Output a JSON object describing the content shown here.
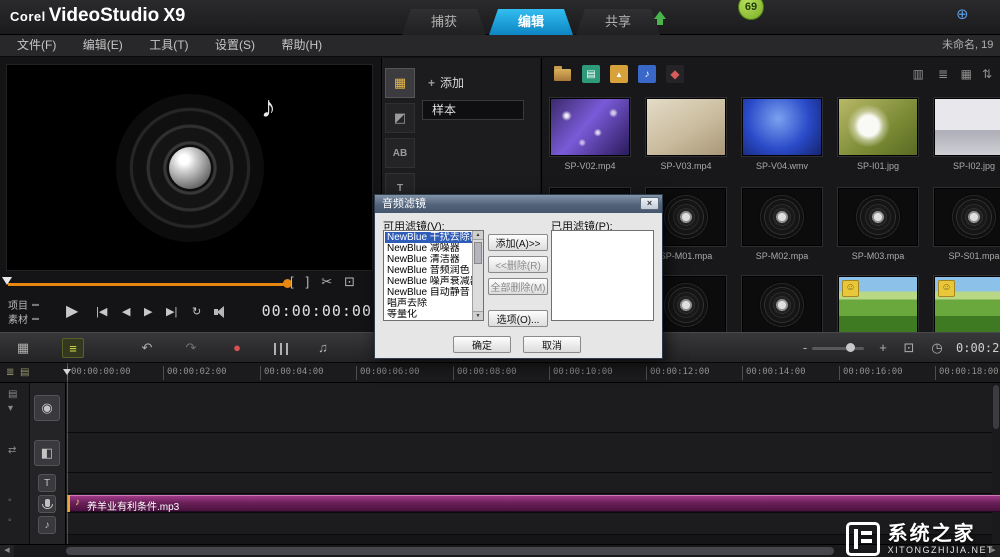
{
  "header": {
    "logo": {
      "corel": "Corel",
      "product": "VideoStudio",
      "version": "X9"
    },
    "tabs": [
      {
        "label": "捕获",
        "active": false
      },
      {
        "label": "编辑",
        "active": true
      },
      {
        "label": "共享",
        "active": false
      }
    ],
    "badge_count": "69"
  },
  "menubar": {
    "items": [
      "文件(F)",
      "编辑(E)",
      "工具(T)",
      "设置(S)",
      "帮助(H)"
    ],
    "project_label": "未命名, 19"
  },
  "preview": {
    "mode_project": "项目",
    "mode_clip": "素材",
    "timecode": "00:00:00:00"
  },
  "options_panel": {
    "add_button": "添加",
    "gallery_label": "样本"
  },
  "library": {
    "row1": [
      {
        "label": "SP-V02.mp4",
        "type": "video-sparkle"
      },
      {
        "label": "SP-V03.mp4",
        "type": "video-beige"
      },
      {
        "label": "SP-V04.wmv",
        "type": "video-blue"
      },
      {
        "label": "SP-I01.jpg",
        "type": "image-dandelion"
      },
      {
        "label": "SP-I02.jpg",
        "type": "image-winter"
      }
    ],
    "row2": [
      {
        "label": "",
        "type": "audio-record"
      },
      {
        "label": "SP-M01.mpa",
        "type": "audio-record"
      },
      {
        "label": "SP-M02.mpa",
        "type": "audio-record"
      },
      {
        "label": "SP-M03.mpa",
        "type": "audio-record"
      },
      {
        "label": "SP-S01.mpa",
        "type": "audio-record"
      }
    ],
    "row3": [
      {
        "type": "audio-record"
      },
      {
        "type": "audio-record"
      },
      {
        "type": "audio-record"
      },
      {
        "type": "video-field"
      },
      {
        "type": "video-field"
      }
    ]
  },
  "dialog": {
    "title": "音频滤镜",
    "available_label": "可用滤镜(V):",
    "applied_label": "已用滤镜(P):",
    "available_filters": [
      {
        "label": "NewBlue 干扰去除器",
        "selected": true
      },
      {
        "label": "NewBlue 减噪器",
        "selected": false
      },
      {
        "label": "NewBlue 清洁器",
        "selected": false
      },
      {
        "label": "NewBlue 音频润色",
        "selected": false
      },
      {
        "label": "NewBlue 噪声衰减器",
        "selected": false
      },
      {
        "label": "NewBlue 自动静音",
        "selected": false
      },
      {
        "label": "唱声去除",
        "selected": false
      },
      {
        "label": "等量化",
        "selected": false
      }
    ],
    "buttons": {
      "add": "添加(A)>>",
      "remove": "<<删除(R)",
      "remove_all": "全部删除(M)",
      "options": "选项(O)...",
      "ok": "确定",
      "cancel": "取消"
    }
  },
  "timeline": {
    "ruler": [
      "00:00:00:00",
      "00:00:02:00",
      "00:00:04:00",
      "00:00:06:00",
      "00:00:08:00",
      "00:00:10:00",
      "00:00:12:00",
      "00:00:14:00",
      "00:00:16:00",
      "00:00:18:00"
    ],
    "clip_label": "养羊业有利条件.mp3",
    "duration": "0:00:2"
  },
  "watermark": {
    "brand": "系统之家",
    "site": "XITONGZHIJIA.NET"
  },
  "icons": {
    "globe": "⊕",
    "close": "×",
    "note": "♪",
    "add_plus": "+",
    "play": "▶",
    "go_start": "|◀",
    "prev_frame": "◀",
    "next_frame": "▶",
    "go_end": "▶|",
    "repeat": "↻",
    "mark_in": "[",
    "mark_out": "]",
    "split": "✂",
    "enlarge": "⊡",
    "media": "▦",
    "instant_project": "◩",
    "transition_ab": "AB",
    "title_t": "T",
    "film": "▤",
    "photo": "▲",
    "music_note": "♪",
    "pinwheel": "◆",
    "view_thumb": "▥",
    "view_list": "≣",
    "view_grid": "▦",
    "sort": "⇅",
    "storyboard": "▦",
    "timeline_view": "≡",
    "undo": "↶",
    "redo": "↷",
    "record": "●",
    "automusic": "♫",
    "zoom_out": "-",
    "zoom_in": "+",
    "clock": "◷",
    "fit": "⊡",
    "ruler_tool1": "≣",
    "ruler_tool2": "▤",
    "gutter_track": "▤",
    "gutter_chevron": "▾",
    "gutter_swap": "⇄",
    "gutter_dot": "◦",
    "track_video": "◉",
    "track_overlay": "◧",
    "track_title": "T",
    "track_music": "♪",
    "scroll_left": "◀",
    "scroll_right": "▶",
    "list_up": "▲",
    "list_down": "▼",
    "mode_strip": "▬"
  }
}
